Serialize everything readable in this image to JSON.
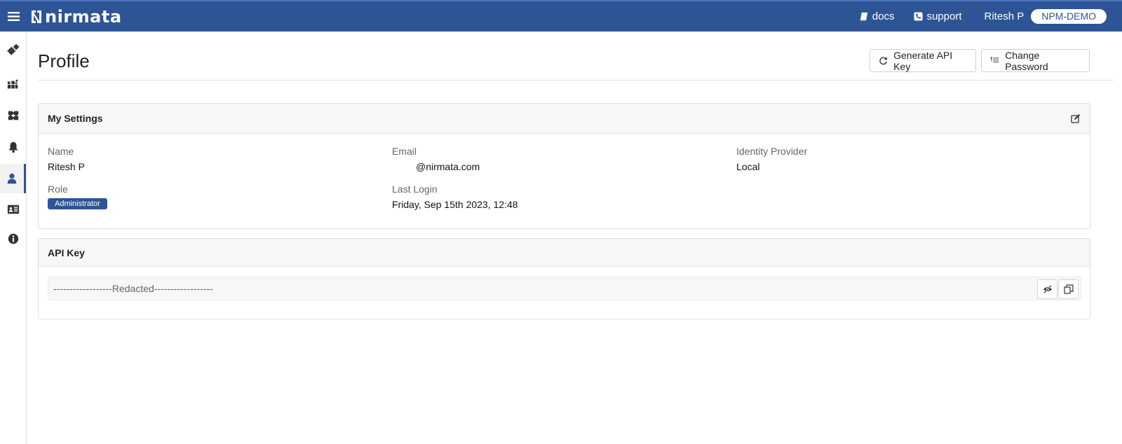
{
  "app": {
    "logo_text": "nirmata",
    "logo_icon": "nirmata-logo-icon",
    "accent_color": "#2d5596"
  },
  "header": {
    "menu_icon": "hamburger-icon",
    "links": [
      {
        "label": "docs",
        "icon": "book-icon"
      },
      {
        "label": "support",
        "icon": "phone-icon"
      }
    ],
    "user_name": "Ritesh P",
    "org_label": "NPM-DEMO"
  },
  "sidebar": {
    "items": [
      {
        "name": "settings",
        "icon": "gears-icon",
        "active": false
      },
      {
        "name": "clusters",
        "icon": "cubes-icon",
        "active": false
      },
      {
        "name": "policies",
        "icon": "puzzle-icon",
        "active": false
      },
      {
        "name": "alerts",
        "icon": "bell-icon",
        "active": false
      },
      {
        "name": "profile",
        "icon": "user-icon",
        "active": true
      },
      {
        "name": "account",
        "icon": "id-card-icon",
        "active": false
      },
      {
        "name": "info",
        "icon": "info-icon",
        "active": false
      }
    ]
  },
  "page": {
    "title": "Profile",
    "actions": {
      "generate_api_key": "Generate API Key",
      "change_password": "Change Password"
    }
  },
  "settings_panel": {
    "title": "My Settings",
    "name_label": "Name",
    "name_value": "Ritesh P",
    "email_label": "Email",
    "email_value": "@nirmata.com",
    "idp_label": "Identity Provider",
    "idp_value": "Local",
    "role_label": "Role",
    "role_value": "Administrator",
    "last_login_label": "Last Login",
    "last_login_value": "Friday, Sep 15th 2023, 12:48"
  },
  "api_panel": {
    "title": "API Key",
    "key_value": "------------------Redacted------------------"
  }
}
